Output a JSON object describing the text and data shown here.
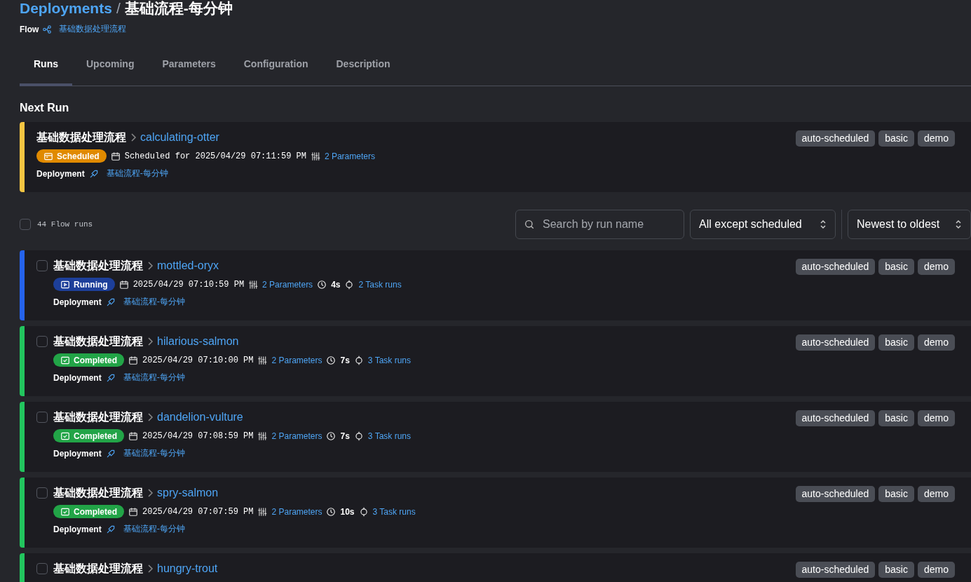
{
  "breadcrumb": {
    "parent": "Deployments",
    "separator": "/",
    "title": "基础流程-每分钟"
  },
  "flow": {
    "label": "Flow",
    "name": "基础数据处理流程"
  },
  "tabs": [
    {
      "label": "Runs",
      "selected": true
    },
    {
      "label": "Upcoming",
      "selected": false
    },
    {
      "label": "Parameters",
      "selected": false
    },
    {
      "label": "Configuration",
      "selected": false
    },
    {
      "label": "Description",
      "selected": false
    }
  ],
  "next_run": {
    "heading": "Next Run",
    "run": {
      "color": "#f5c542",
      "flow": "基础数据处理流程",
      "name": "calculating-otter",
      "state": {
        "kind": "scheduled",
        "label": "Scheduled"
      },
      "time": "Scheduled for 2025/04/29 07:11:59 PM",
      "parameters": "2 Parameters",
      "deployment_label": "Deployment",
      "deployment": "基础流程-每分钟",
      "tags": [
        "auto-scheduled",
        "basic",
        "demo"
      ]
    }
  },
  "toolbar": {
    "select_all": {
      "checked": false
    },
    "count": "44 Flow runs",
    "search": {
      "placeholder": "Search by run name"
    },
    "filter": "All except scheduled",
    "sort": "Newest to oldest"
  },
  "runs": [
    {
      "color": "#2563eb",
      "checked": false,
      "flow": "基础数据处理流程",
      "name": "mottled-oryx",
      "state": {
        "kind": "running",
        "label": "Running"
      },
      "time": "2025/04/29 07:10:59 PM",
      "parameters": "2 Parameters",
      "duration": "4s",
      "task_runs": "2 Task runs",
      "deployment_label": "Deployment",
      "deployment": "基础流程-每分钟",
      "tags": [
        "auto-scheduled",
        "basic",
        "demo"
      ]
    },
    {
      "color": "#22c55e",
      "checked": false,
      "flow": "基础数据处理流程",
      "name": "hilarious-salmon",
      "state": {
        "kind": "completed",
        "label": "Completed"
      },
      "time": "2025/04/29 07:10:00 PM",
      "parameters": "2 Parameters",
      "duration": "7s",
      "task_runs": "3 Task runs",
      "deployment_label": "Deployment",
      "deployment": "基础流程-每分钟",
      "tags": [
        "auto-scheduled",
        "basic",
        "demo"
      ]
    },
    {
      "color": "#22c55e",
      "checked": false,
      "flow": "基础数据处理流程",
      "name": "dandelion-vulture",
      "state": {
        "kind": "completed",
        "label": "Completed"
      },
      "time": "2025/04/29 07:08:59 PM",
      "parameters": "2 Parameters",
      "duration": "7s",
      "task_runs": "3 Task runs",
      "deployment_label": "Deployment",
      "deployment": "基础流程-每分钟",
      "tags": [
        "auto-scheduled",
        "basic",
        "demo"
      ]
    },
    {
      "color": "#22c55e",
      "checked": false,
      "flow": "基础数据处理流程",
      "name": "spry-salmon",
      "state": {
        "kind": "completed",
        "label": "Completed"
      },
      "time": "2025/04/29 07:07:59 PM",
      "parameters": "2 Parameters",
      "duration": "10s",
      "task_runs": "3 Task runs",
      "deployment_label": "Deployment",
      "deployment": "基础流程-每分钟",
      "tags": [
        "auto-scheduled",
        "basic",
        "demo"
      ]
    },
    {
      "color": "#22c55e",
      "checked": false,
      "flow": "基础数据处理流程",
      "name": "hungry-trout",
      "tags": [
        "auto-scheduled",
        "basic",
        "demo"
      ]
    }
  ]
}
